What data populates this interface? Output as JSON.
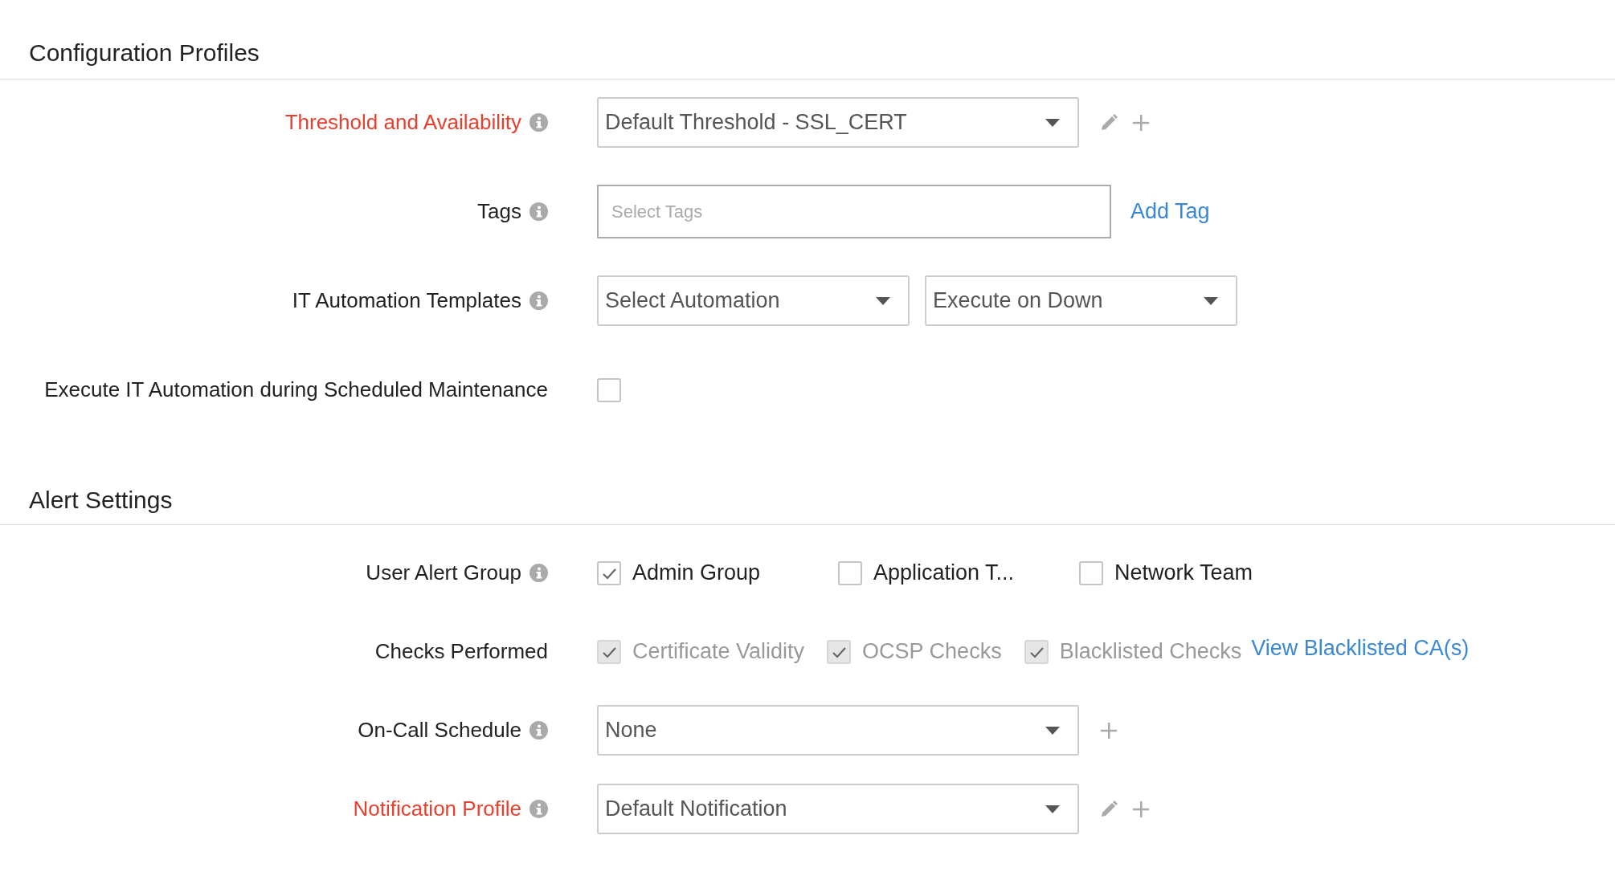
{
  "sections": [
    {
      "title": "Configuration Profiles",
      "rows": [
        {
          "kind": "select",
          "label": "Threshold and Availability",
          "required": true,
          "info": true,
          "value": "Default Threshold - SSL_CERT",
          "edit": true,
          "add": true
        },
        {
          "kind": "tags",
          "label": "Tags",
          "required": false,
          "info": true,
          "placeholder": "Select Tags",
          "link": "Add Tag"
        },
        {
          "kind": "select_pair",
          "label": "IT Automation Templates",
          "required": false,
          "info": true,
          "values": [
            "Select Automation",
            "Execute on Down"
          ]
        },
        {
          "kind": "checkbox",
          "label": "Execute IT Automation during Scheduled Maintenance",
          "required": false,
          "info": false,
          "checked": false
        }
      ]
    },
    {
      "title": "Alert Settings",
      "rows": [
        {
          "kind": "checkbox_group",
          "label": "User Alert Group",
          "required": false,
          "info": true,
          "options": [
            {
              "label": "Admin Group",
              "checked": true,
              "disabled": false
            },
            {
              "label": "Application T...",
              "checked": false,
              "disabled": false
            },
            {
              "label": "Network Team",
              "checked": false,
              "disabled": false
            }
          ]
        },
        {
          "kind": "checkbox_group",
          "label": "Checks Performed",
          "required": false,
          "info": false,
          "options": [
            {
              "label": "Certificate Validity",
              "checked": true,
              "disabled": true
            },
            {
              "label": "OCSP Checks",
              "checked": true,
              "disabled": true
            },
            {
              "label": "Blacklisted Checks",
              "checked": true,
              "disabled": true
            }
          ],
          "link": "View Blacklisted CA(s)"
        },
        {
          "kind": "select",
          "label": "On-Call Schedule",
          "required": false,
          "info": true,
          "value": "None",
          "edit": false,
          "add": true
        },
        {
          "kind": "select",
          "label": "Notification Profile",
          "required": true,
          "info": true,
          "value": "Default Notification",
          "edit": true,
          "add": true
        }
      ]
    }
  ]
}
